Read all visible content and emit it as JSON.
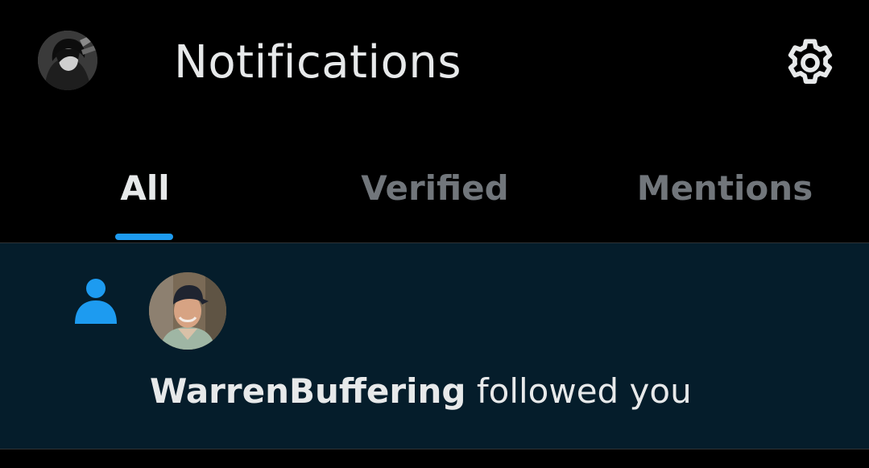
{
  "header": {
    "title": "Notifications",
    "avatar_icon": "user-avatar",
    "settings_icon": "gear-icon"
  },
  "tabs": [
    {
      "label": "All",
      "active": true
    },
    {
      "label": "Verified",
      "active": false
    },
    {
      "label": "Mentions",
      "active": false
    }
  ],
  "notification": {
    "type_icon": "person-icon",
    "username": "WarrenBuffering",
    "action": " followed you"
  },
  "colors": {
    "accent": "#1d9bf0",
    "text_primary": "#e7e9ea",
    "text_secondary": "#71767b",
    "unread_background": "#051d2b"
  }
}
